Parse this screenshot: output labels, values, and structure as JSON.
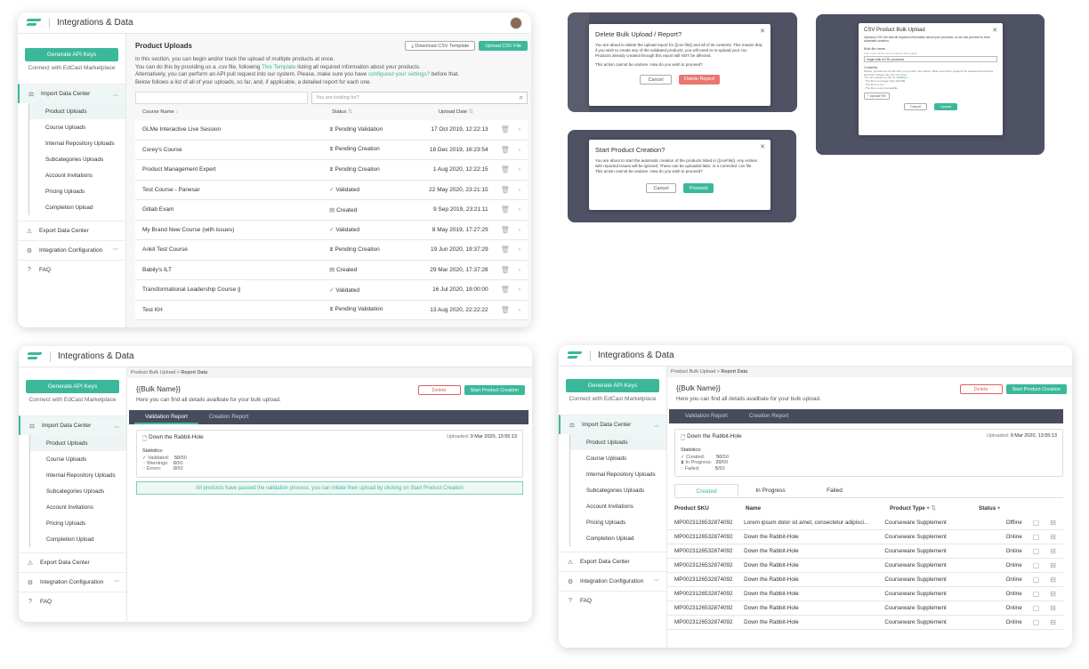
{
  "app": {
    "title": "Integrations & Data",
    "generate_api": "Generate API Keys",
    "marketplace": "Connect with EdCast Marketplace"
  },
  "sidebar": {
    "import": "Import Data Center",
    "items": [
      "Product Uploads",
      "Course Uploads",
      "Internal Repository Uploads",
      "Subcategories Uploads",
      "Account Invitations",
      "Pricing Uploads",
      "Completion Upload"
    ],
    "export": "Export Data Center",
    "config": "Integration Configuration",
    "faq": "FAQ"
  },
  "uploads": {
    "title": "Product Uploads",
    "download_btn": "Download CSV Template",
    "upload_btn": "Upload CSV File",
    "desc1": "In this section, you can begin and/or track the upload of multiple products at once.",
    "desc2a": "You can do this by providing us a .csv file, following",
    "desc2_link": "This Template",
    "desc2b": "listing all required information about your products.",
    "desc3a": "Alternatively, you can perform an API pull request into our system. Please, make sure you have",
    "desc3_link": "configured your settings?",
    "desc3b": "before that.",
    "desc4": "Below follows a list of all of your uploads, so far, and, if applicable, a detailed report for each one.",
    "search_placeholder": "You are looking for?",
    "col_name": "Course Name",
    "col_status": "Status",
    "col_date": "Upload Date",
    "rows": [
      {
        "name": "GLMe Interactive Live Session",
        "status": "Pending Validation",
        "date": "17 Oct 2019, 12:22:13"
      },
      {
        "name": "Corey's Course",
        "status": "Pending Creation",
        "date": "18 Dec 2019, 16:23:54"
      },
      {
        "name": "Product Management Expert",
        "status": "Pending Creation",
        "date": "1 Aug 2020, 12:22:15"
      },
      {
        "name": "Test Course - Panesar",
        "status": "Validated",
        "date": "22 May 2020, 23:21:15"
      },
      {
        "name": "Gitlab Exam",
        "status": "Created",
        "date": "9 Sep 2019, 23:21:11"
      },
      {
        "name": "My Brand New Course (with issues)",
        "status": "Validated",
        "date": "8 May 2019, 17:27:29"
      },
      {
        "name": "Ankit Test Course",
        "status": "Pending Creation",
        "date": "19 Jun 2020, 19:37:29"
      },
      {
        "name": "Babily's ILT",
        "status": "Created",
        "date": "29 Mar 2020, 17:37:28"
      },
      {
        "name": "Transformational Leadership Course ||",
        "status": "Validated",
        "date": "16 Jul 2020, 19:00:00"
      },
      {
        "name": "Test KH",
        "status": "Pending Validation",
        "date": "13 Aug 2020, 22:22:22"
      }
    ]
  },
  "dialogs": {
    "delete": {
      "title": "Delete Bulk Upload / Report?",
      "body": "You are about to delete the upload report for {{csv file}} and all of its contents. This means that, if you wish to create any of the validated products, you will need to re-upload your csv. Products already created through this report will NOT be affected.",
      "body2": "This action cannot be undone. How do you wish to proceed?",
      "cancel": "Cancel",
      "confirm": "Delete Report"
    },
    "start": {
      "title": "Start Product Creation?",
      "body": "You are about to start the automatic creation of the products listed in {{csvFile}}. Any entries with reported issues will be ignored. These can be uploaded later, in a corrected .csv file.",
      "body2": "This action cannot be undone. How do you wish to proceed?",
      "cancel": "Cancel",
      "confirm": "Proceed"
    },
    "csv": {
      "title": "CSV Product Bulk Upload",
      "body": "Upload a CSV file with all required information about your products, so we can proceed to their automatic creation.",
      "label": "Bulk file name",
      "hint": "This name will be used to identify this upload",
      "value": "Huge bulk of ITIL products",
      "contents": "Contents",
      "contents_hint": "Please, provide the csv file with your product information. Make sure that it respects the standard listed below and that it follows the",
      "contents_link": "CSV Template",
      "req_title": "You can upload one file for validation:",
      "req1": "- The file is not larger than 100 MB",
      "req2": "- The file is a csv",
      "req3": "- The file is excel compatible",
      "upload": "Upload File",
      "cancel": "Cancel",
      "confirm": "Upload"
    }
  },
  "report": {
    "crumb_a": "Product Bulk Upload",
    "crumb_b": "Report Data",
    "name": "{{Bulk Name}}",
    "desc": "Here you can find all details availbale for your bulk upload.",
    "delete": "Delete",
    "start": "Start Product Creation",
    "tab_val": "Validation Report",
    "tab_cre": "Creation Report",
    "file": "Down the Rabbit-Hole",
    "uploaded": "Uploaded:",
    "uploaded_date": "9 Mar 2020, 13:55:13",
    "stats": "Statistics:",
    "validated": "Validated:",
    "validated_n": "50",
    "validated_t": "/50",
    "warnings": "Warnings:",
    "warnings_n": "0",
    "warnings_t": "/50",
    "errors": "Errors:",
    "errors_n": "0",
    "errors_t": "/50",
    "banner": "All products have passed the validation process, you can initate their upload by clicking on Start Product Creation",
    "created": "Created:",
    "created_n": "50",
    "created_t": "/50",
    "inprog": "In Progress:",
    "inprog_n": "20",
    "inprog_t": "/50",
    "failed": "Failed:",
    "failed_n": "5",
    "failed_t": "/50",
    "subtabs": [
      "Created",
      "In Progress",
      "Failed"
    ],
    "cols": [
      "Product SKU",
      "Name",
      "Product Type",
      "Status"
    ],
    "sku": "MP0023126532874092",
    "type": "Courseware Supplement",
    "rows": [
      {
        "name": "Lorem ipsum dolor sit amet, consectetur adipisci...",
        "status": "Offline"
      },
      {
        "name": "Down the Rabbit-Hole",
        "status": "Online"
      },
      {
        "name": "Down the Rabbit-Hole",
        "status": "Online"
      },
      {
        "name": "Down the Rabbit-Hole",
        "status": "Online"
      },
      {
        "name": "Down the Rabbit-Hole",
        "status": "Online"
      },
      {
        "name": "Down the Rabbit-Hole",
        "status": "Online"
      },
      {
        "name": "Down the Rabbit-Hole",
        "status": "Online"
      },
      {
        "name": "Down the Rabbit-Hole",
        "status": "Online"
      }
    ]
  },
  "colors": {
    "accent": "#3bb89a",
    "dark": "#4f5264",
    "danger": "#e06060"
  }
}
